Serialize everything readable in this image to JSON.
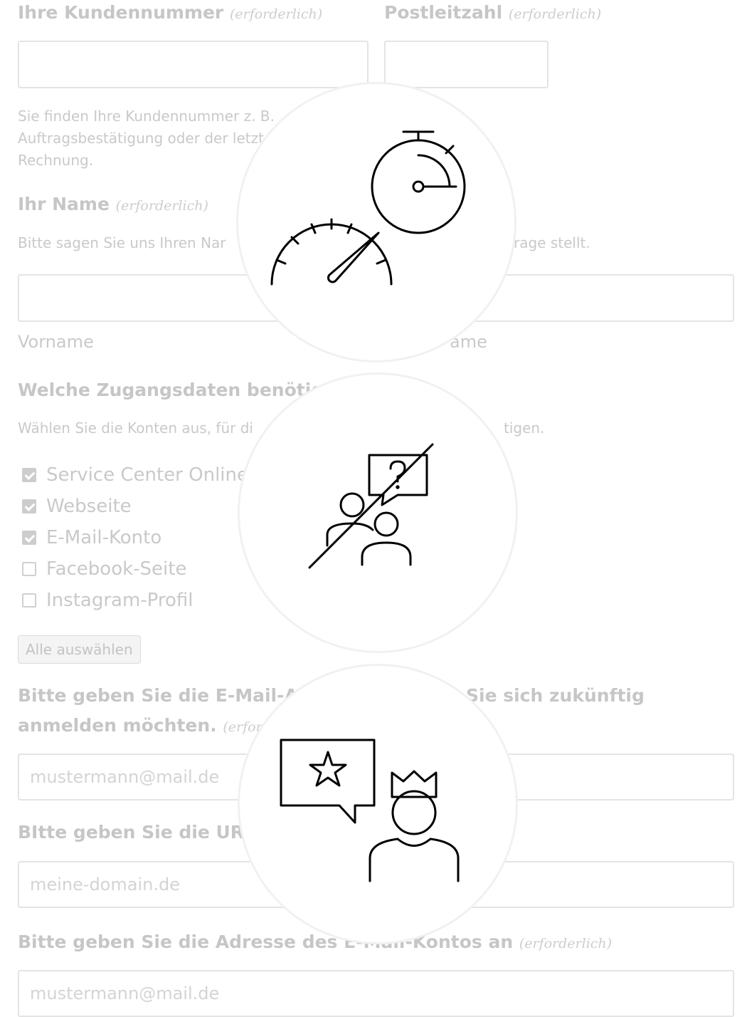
{
  "form": {
    "customer_number": {
      "label": "Ihre Kundennummer",
      "required": "(erforderlich)",
      "value": "",
      "help": [
        "Sie finden Ihre Kundennummer z. B.",
        "Auftragsbestätigung oder der letzten",
        "Rechnung."
      ]
    },
    "postal_code": {
      "label": "Postleitzahl",
      "required": "(erforderlich)",
      "value": ""
    },
    "name": {
      "label": "Ihr Name",
      "required": "(erforderlich)",
      "help": "Bitte sagen Sie uns Ihren Namen, … Anfrage stellt.",
      "help_left": "Bitte sagen Sie uns Ihren Nar",
      "help_right": "rage stellt.",
      "first_label": "Vorname",
      "last_label_fragment": "ame"
    },
    "access": {
      "label": "Welche Zugangsdaten benötig",
      "help_left": "Wählen Sie die Konten aus, für di",
      "help_right": "tigen.",
      "options": [
        {
          "label": "Service Center Online",
          "checked": true
        },
        {
          "label": "Webseite",
          "checked": true
        },
        {
          "label": "E-Mail-Konto",
          "checked": true
        },
        {
          "label": "Facebook-Seite",
          "checked": false
        },
        {
          "label": "Instagram-Profil",
          "checked": false
        }
      ],
      "select_all": "Alle auswählen"
    },
    "login_email": {
      "label_line1_left": "Bitte geben Sie die E-Mail-A",
      "label_line1_right": "Sie sich zukünftig",
      "label_line2": "anmelden möchten.",
      "required_fragment": "(erfor",
      "placeholder": "mustermann@mail.de"
    },
    "url": {
      "label": "BItte geben Sie die URL",
      "placeholder": "meine-domain.de"
    },
    "mailbox": {
      "label": "Bitte geben Sie die Adresse des E-Mail-Kontos an",
      "required": "(erforderlich)",
      "placeholder": "mustermann@mail.de"
    }
  },
  "icons": [
    "speedometer-stopwatch-icon",
    "no-questions-people-icon",
    "customer-king-rating-icon"
  ],
  "colors": {
    "muted_text": "#c6c6c6",
    "input_border": "#e4e4e4",
    "icon_stroke": "#000000",
    "circle_border": "#f1f1f1"
  }
}
